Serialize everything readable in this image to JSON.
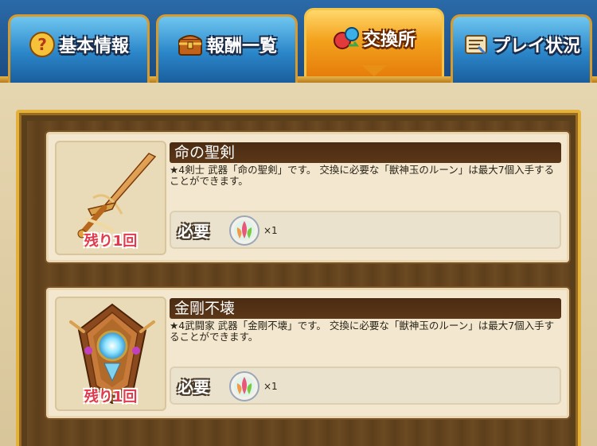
{
  "tabs": [
    {
      "label": "基本情報",
      "icon": "question-icon",
      "active": false
    },
    {
      "label": "報酬一覧",
      "icon": "treasure-chest-icon",
      "active": false
    },
    {
      "label": "交換所",
      "icon": "exchange-icon",
      "active": true
    },
    {
      "label": "プレイ状況",
      "icon": "scroll-map-icon",
      "active": false
    }
  ],
  "items": [
    {
      "name": "命の聖剣",
      "description": "★4剣士 武器「命の聖剣」です。 交換に必要な「獣神玉のルーン」は最大7個入手することができます。",
      "remaining": "残り1回",
      "required_label": "必要",
      "required_qty": "×1",
      "item_icon": "sword-icon",
      "cost_icon": "rune-orb-icon"
    },
    {
      "name": "金剛不壊",
      "description": "★4武闘家 武器「金剛不壊」です。 交換に必要な「獣神玉のルーン」は最大7個入手することができます。",
      "remaining": "残り1回",
      "required_label": "必要",
      "required_qty": "×1",
      "item_icon": "claw-gauntlet-icon",
      "cost_icon": "rune-orb-icon"
    }
  ],
  "colors": {
    "tab_blue": "#2b86c9",
    "tab_active": "#f3a21d",
    "remain_red": "#e23a4d",
    "title_bar": "#4a2b12"
  }
}
